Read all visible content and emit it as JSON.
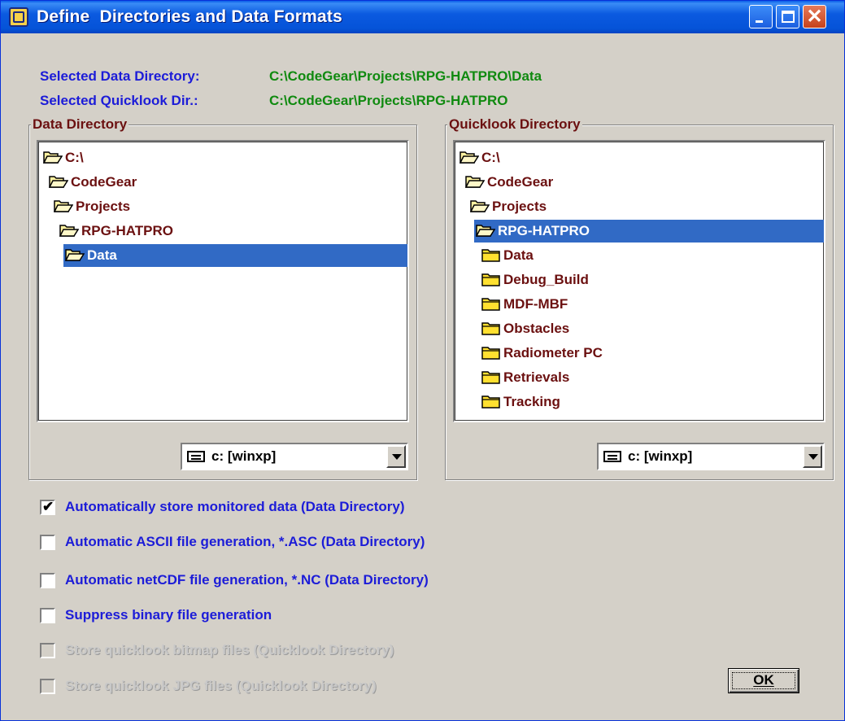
{
  "window": {
    "title": "Define  Directories and Data Formats",
    "titlebar_color": "#0553d8"
  },
  "info": {
    "data_dir_label": "Selected Data Directory:",
    "data_dir_value": "C:\\CodeGear\\Projects\\RPG-HATPRO\\Data",
    "quicklook_dir_label": "Selected Quicklook Dir.:",
    "quicklook_dir_value": "C:\\CodeGear\\Projects\\RPG-HATPRO"
  },
  "data_directory": {
    "legend": "Data Directory",
    "items": [
      {
        "label": "C:\\",
        "icon": "folder-open-icon"
      },
      {
        "label": "CodeGear",
        "icon": "folder-open-icon"
      },
      {
        "label": "Projects",
        "icon": "folder-open-icon"
      },
      {
        "label": "RPG-HATPRO",
        "icon": "folder-open-icon"
      },
      {
        "label": "Data",
        "icon": "folder-open-icon",
        "selected": true
      }
    ],
    "drive": "c: [winxp]"
  },
  "quicklook_directory": {
    "legend": "Quicklook Directory",
    "items": [
      {
        "label": "C:\\",
        "icon": "folder-open-icon"
      },
      {
        "label": "CodeGear",
        "icon": "folder-open-icon"
      },
      {
        "label": "Projects",
        "icon": "folder-open-icon"
      },
      {
        "label": "RPG-HATPRO",
        "icon": "folder-open-icon",
        "selected": true
      },
      {
        "label": "Data",
        "icon": "folder-closed-icon"
      },
      {
        "label": "Debug_Build",
        "icon": "folder-closed-icon"
      },
      {
        "label": "MDF-MBF",
        "icon": "folder-closed-icon"
      },
      {
        "label": "Obstacles",
        "icon": "folder-closed-icon"
      },
      {
        "label": "Radiometer PC",
        "icon": "folder-closed-icon"
      },
      {
        "label": "Retrievals",
        "icon": "folder-closed-icon"
      },
      {
        "label": "Tracking",
        "icon": "folder-closed-icon"
      }
    ],
    "drive": "c: [winxp]"
  },
  "options": [
    {
      "label": "Automatically store monitored data (Data Directory)",
      "checked": true,
      "enabled": true
    },
    {
      "label": "Automatic ASCII file generation, *.ASC (Data Directory)",
      "checked": false,
      "enabled": true
    },
    {
      "label": "Automatic netCDF file generation, *.NC (Data Directory)",
      "checked": false,
      "enabled": true
    },
    {
      "label": "Suppress binary file generation",
      "checked": false,
      "enabled": true
    },
    {
      "label": "Store quicklook bitmap  files (Quicklook Directory)",
      "checked": false,
      "enabled": false
    },
    {
      "label": "Store quicklook JPG files (Quicklook Directory)",
      "checked": false,
      "enabled": false
    }
  ],
  "ok_button": {
    "label": "OK"
  },
  "colors": {
    "label_blue": "#1c1cd8",
    "value_green": "#108a10",
    "tree_text": "#6b1010",
    "selection": "#316ac5"
  }
}
